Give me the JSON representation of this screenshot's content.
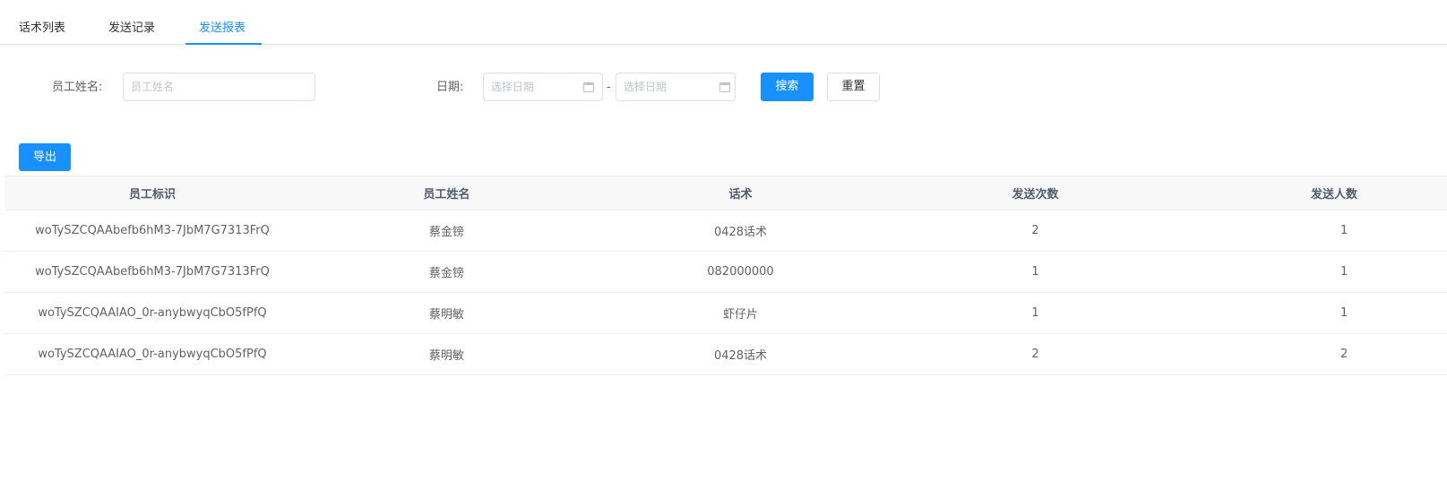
{
  "tabs": [
    {
      "label": "话术列表",
      "active": false
    },
    {
      "label": "发送记录",
      "active": false
    },
    {
      "label": "发送报表",
      "active": true
    }
  ],
  "filters": {
    "employee_name_label": "员工姓名:",
    "employee_name_placeholder": "员工姓名",
    "employee_name_value": "",
    "date_label": "日期:",
    "date_start_placeholder": "选择日期",
    "date_end_placeholder": "选择日期",
    "date_separator": "-",
    "search_label": "搜索",
    "reset_label": "重置"
  },
  "toolbar": {
    "export_label": "导出"
  },
  "table": {
    "columns": [
      "员工标识",
      "员工姓名",
      "话术",
      "发送次数",
      "发送人数"
    ],
    "rows": [
      [
        "woTySZCQAAbefb6hM3-7JbM7G7313FrQ",
        "蔡金镑",
        "0428话术",
        "2",
        "1"
      ],
      [
        "woTySZCQAAbefb6hM3-7JbM7G7313FrQ",
        "蔡金镑",
        "082000000",
        "1",
        "1"
      ],
      [
        "woTySZCQAAIAO_0r-anybwyqCbO5fPfQ",
        "蔡明敏",
        "虾仔片",
        "1",
        "1"
      ],
      [
        "woTySZCQAAIAO_0r-anybwyqCbO5fPfQ",
        "蔡明敏",
        "0428话术",
        "2",
        "2"
      ]
    ]
  },
  "colors": {
    "accent": "#1890ff",
    "header_bg": "#f8f8f9",
    "border": "#ebeef5"
  }
}
